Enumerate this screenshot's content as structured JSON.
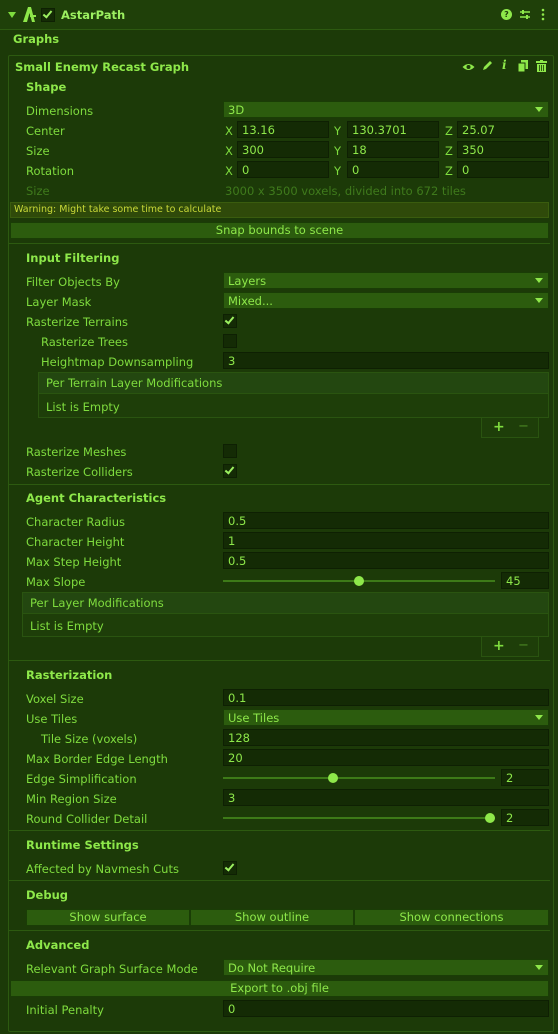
{
  "component": {
    "title": "AstarPath",
    "enabled": true
  },
  "section_title": "Graphs",
  "graph": {
    "name": "Small Enemy Recast Graph",
    "shape": {
      "header": "Shape",
      "dimensions_label": "Dimensions",
      "dimensions_value": "3D",
      "center_label": "Center",
      "center": {
        "x": "13.16",
        "y": "130.3701",
        "z": "25.07"
      },
      "size_label": "Size",
      "size": {
        "x": "300",
        "y": "18",
        "z": "350"
      },
      "rotation_label": "Rotation",
      "rotation": {
        "x": "0",
        "y": "0",
        "z": "0"
      },
      "axis_x": "X",
      "axis_y": "Y",
      "axis_z": "Z",
      "voxel_size_label": "Size",
      "voxel_info": "3000 x 3500 voxels, divided into 672 tiles",
      "warning": "Warning: Might take some time to calculate",
      "snap_button": "Snap bounds to scene"
    },
    "input_filtering": {
      "header": "Input Filtering",
      "filter_label": "Filter Objects By",
      "filter_value": "Layers",
      "layer_mask_label": "Layer Mask",
      "layer_mask_value": "Mixed...",
      "rasterize_terrains_label": "Rasterize Terrains",
      "rasterize_terrains": true,
      "rasterize_trees_label": "Rasterize Trees",
      "rasterize_trees": false,
      "heightmap_label": "Heightmap Downsampling",
      "heightmap_value": "3",
      "per_terrain_label": "Per Terrain Layer Modifications",
      "per_terrain_empty": "List is Empty",
      "rasterize_meshes_label": "Rasterize Meshes",
      "rasterize_meshes": false,
      "rasterize_colliders_label": "Rasterize Colliders",
      "rasterize_colliders": true,
      "plus": "+",
      "minus": "−"
    },
    "agent": {
      "header": "Agent Characteristics",
      "radius_label": "Character Radius",
      "radius_value": "0.5",
      "height_label": "Character Height",
      "height_value": "1",
      "step_label": "Max Step Height",
      "step_value": "0.5",
      "slope_label": "Max Slope",
      "slope_value": "45",
      "slope_fraction": 0.5,
      "per_layer_label": "Per Layer Modifications",
      "per_layer_empty": "List is Empty"
    },
    "rasterization": {
      "header": "Rasterization",
      "voxel_size_label": "Voxel Size",
      "voxel_size_value": "0.1",
      "use_tiles_label": "Use Tiles",
      "use_tiles_value": "Use Tiles",
      "tile_size_label": "Tile Size (voxels)",
      "tile_size_value": "128",
      "border_label": "Max Border Edge Length",
      "border_value": "20",
      "edge_simp_label": "Edge Simplification",
      "edge_simp_value": "2",
      "min_region_label": "Min Region Size",
      "min_region_value": "3",
      "round_collider_label": "Round Collider Detail",
      "round_collider_value": "2"
    },
    "runtime": {
      "header": "Runtime Settings",
      "navmesh_cuts_label": "Affected by Navmesh Cuts",
      "navmesh_cuts": true
    },
    "debug": {
      "header": "Debug",
      "show_surface": "Show surface",
      "show_outline": "Show outline",
      "show_connections": "Show connections"
    },
    "advanced": {
      "header": "Advanced",
      "surface_mode_label": "Relevant Graph Surface Mode",
      "surface_mode_value": "Do Not Require",
      "export_button": "Export to .obj file",
      "penalty_label": "Initial Penalty",
      "penalty_value": "0"
    }
  },
  "colors": {
    "background": "#1c3a08",
    "text": "#7fdc3e",
    "field": "#142b05",
    "button": "#2c5c0e"
  }
}
